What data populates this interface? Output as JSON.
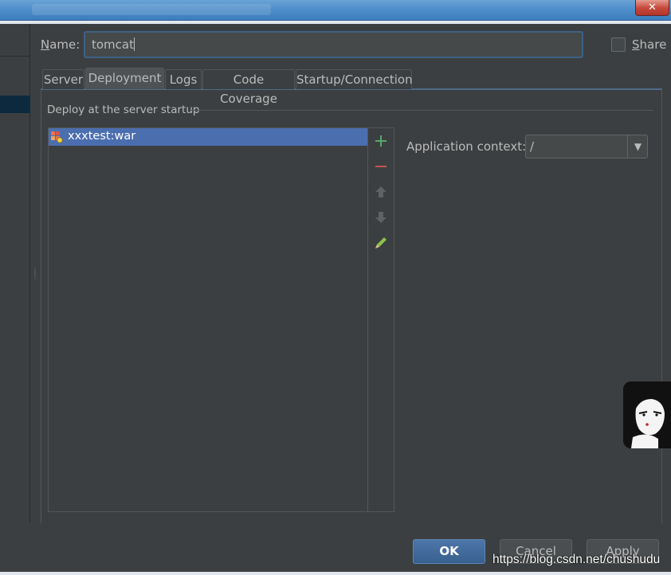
{
  "window": {
    "close_glyph": "✕"
  },
  "name_field": {
    "label_underlined": "N",
    "label_rest": "ame:",
    "value": "tomcat"
  },
  "share": {
    "label_underlined": "S",
    "label_rest": "hare",
    "checked": false
  },
  "tabs": [
    {
      "label": "Server",
      "active": false
    },
    {
      "label": "Deployment",
      "active": true
    },
    {
      "label": "Logs",
      "active": false
    },
    {
      "label": "Code Coverage",
      "active": false
    },
    {
      "label": "Startup/Connection",
      "active": false
    }
  ],
  "deployment": {
    "section_title": "Deploy at the server startup",
    "items": [
      {
        "label": "xxxtest:war",
        "icon": "artifact-war-icon",
        "selected": true
      }
    ],
    "toolbar": {
      "add_icon": "plus-icon",
      "remove_icon": "minus-icon",
      "up_icon": "arrow-up-icon",
      "down_icon": "arrow-down-icon",
      "edit_icon": "pencil-icon"
    }
  },
  "app_context": {
    "label": "Application context:",
    "value": "/",
    "dropdown_glyph": "▼"
  },
  "buttons": {
    "ok": "OK",
    "cancel": "Cancel",
    "apply": "Apply"
  },
  "watermark": "https://blog.csdn.net/chushudu",
  "colors": {
    "background": "#3c3f41",
    "selection": "#4b6eaf",
    "add_green": "#59a869",
    "remove_red": "#c75450",
    "focus_border": "#3d6185"
  }
}
